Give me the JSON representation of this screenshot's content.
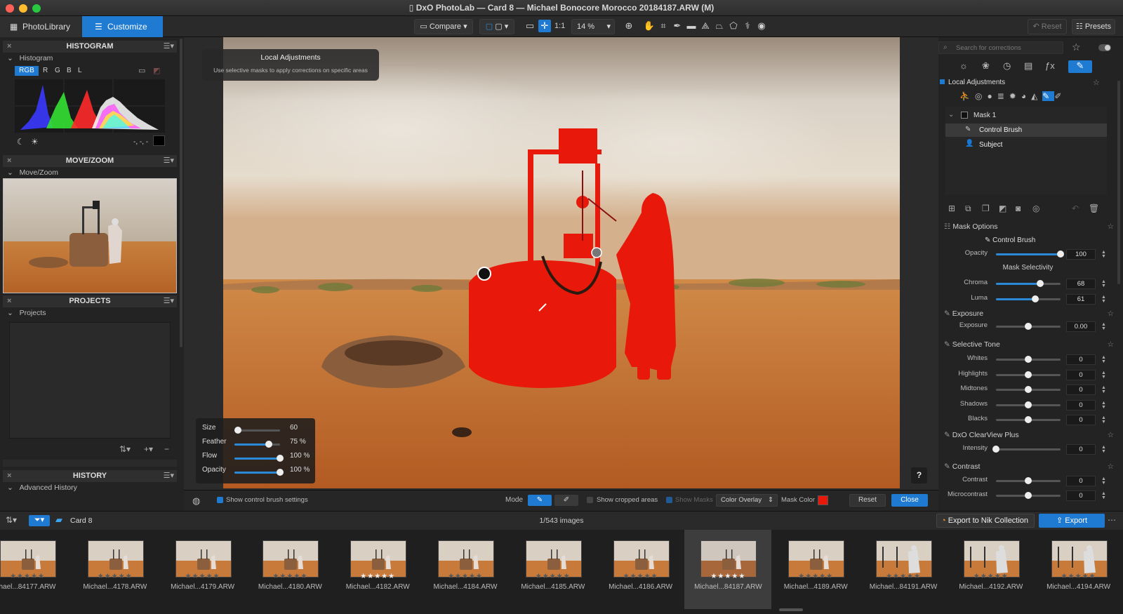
{
  "window": {
    "title": "DxO PhotoLab — Card 8 — Michael Bonocore Morocco 20184187.ARW (M)"
  },
  "toolbar": {
    "tab_library": "PhotoLibrary",
    "tab_customize": "Customize",
    "compare": "Compare",
    "zoom_1to1": "1:1",
    "zoom_level": "14 %",
    "reset": "Reset",
    "presets": "Presets"
  },
  "left_panel": {
    "histogram_title": "HISTOGRAM",
    "histogram_label": "Histogram",
    "channels": [
      "RGB",
      "R",
      "G",
      "B",
      "L"
    ],
    "histogram_readout": "-, -, -",
    "movezoom_title": "MOVE/ZOOM",
    "movezoom_label": "Move/Zoom",
    "projects_title": "PROJECTS",
    "projects_label": "Projects",
    "history_title": "HISTORY",
    "history_label": "Advanced History"
  },
  "tooltip": {
    "title": "Local Adjustments",
    "text": "Use selective masks to apply corrections on specific areas"
  },
  "brush": {
    "size_label": "Size",
    "size_value": "60",
    "size_level": 0.08,
    "feather_label": "Feather",
    "feather_value": "75 %",
    "feather_level": 0.75,
    "flow_label": "Flow",
    "flow_value": "100 %",
    "flow_level": 1.0,
    "opacity_label": "Opacity",
    "opacity_value": "100 %",
    "opacity_level": 1.0
  },
  "bottom_bar": {
    "show_brush_settings": "Show control brush settings",
    "mode": "Mode",
    "show_cropped": "Show cropped areas",
    "show_masks": "Show Masks",
    "overlay": "Color Overlay",
    "mask_color": "Mask Color",
    "reset": "Reset",
    "close": "Close",
    "help": "?"
  },
  "right_panel": {
    "search_placeholder": "Search for corrections",
    "local_adjustments": "Local Adjustments",
    "mask_name": "Mask 1",
    "mask_items": [
      "Control Brush",
      "Subject"
    ],
    "mask_options": "Mask Options",
    "control_brush": "Control Brush",
    "opacity_label": "Opacity",
    "opacity_value": "100",
    "opacity_level": 1.0,
    "mask_selectivity": "Mask Selectivity",
    "chroma_label": "Chroma",
    "chroma_value": "68",
    "chroma_level": 0.68,
    "luma_label": "Luma",
    "luma_value": "61",
    "luma_level": 0.61,
    "exposure_section": "Exposure",
    "exposure_label": "Exposure",
    "exposure_value": "0.00",
    "exposure_level": 0.5,
    "selective_tone_section": "Selective Tone",
    "tone_rows": [
      {
        "label": "Whites",
        "value": "0"
      },
      {
        "label": "Highlights",
        "value": "0"
      },
      {
        "label": "Midtones",
        "value": "0"
      },
      {
        "label": "Shadows",
        "value": "0"
      },
      {
        "label": "Blacks",
        "value": "0"
      }
    ],
    "clearview_section": "DxO ClearView Plus",
    "intensity_label": "Intensity",
    "intensity_value": "0",
    "intensity_level": 0.0,
    "contrast_section": "Contrast",
    "contrast_label": "Contrast",
    "contrast_value": "0",
    "microcontrast_label": "Microcontrast",
    "microcontrast_value": "0"
  },
  "filmstrip_bar": {
    "folder": "Card 8",
    "count": "1/543 images",
    "export_nik": "Export to Nik Collection",
    "export": "Export"
  },
  "filmstrip": [
    {
      "name": "hael...84177.ARW",
      "stars": "★★★★★",
      "rated": false
    },
    {
      "name": "Michael...4178.ARW",
      "stars": "★★★★★",
      "rated": false
    },
    {
      "name": "Michael...4179.ARW",
      "stars": "★★★★★",
      "rated": false
    },
    {
      "name": "Michael...4180.ARW",
      "stars": "★★★★★",
      "rated": false
    },
    {
      "name": "Michael...4182.ARW",
      "stars": "★★★★★",
      "rated": true
    },
    {
      "name": "Michael...4184.ARW",
      "stars": "★★★★★",
      "rated": false
    },
    {
      "name": "Michael...4185.ARW",
      "stars": "★★★★★",
      "rated": false
    },
    {
      "name": "Michael...4186.ARW",
      "stars": "★★★★★",
      "rated": false
    },
    {
      "name": "Michael...84187.ARW",
      "stars": "★★★★★",
      "rated": true
    },
    {
      "name": "Michael...4189.ARW",
      "stars": "★★★★★",
      "rated": false
    },
    {
      "name": "Michael...84191.ARW",
      "stars": "★★★★★",
      "rated": false
    },
    {
      "name": "Michael...4192.ARW",
      "stars": "★★★★★",
      "rated": false
    },
    {
      "name": "Michael...4194.ARW",
      "stars": "★★★★★",
      "rated": false
    }
  ],
  "colors": {
    "accent": "#1f7ad1",
    "mask_red": "#e8190a",
    "sand": "#c9733a"
  }
}
